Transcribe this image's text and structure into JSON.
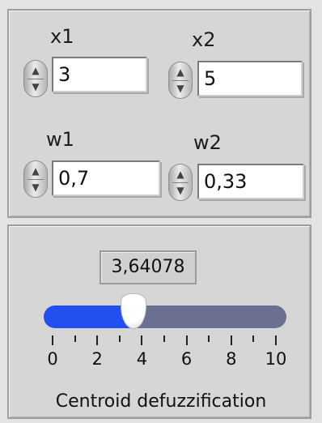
{
  "inputs": {
    "x1": {
      "label": "x1",
      "value": "3"
    },
    "x2": {
      "label": "x2",
      "value": "5"
    },
    "w1": {
      "label": "w1",
      "value": "0,7"
    },
    "w2": {
      "label": "w2",
      "value": "0,33"
    }
  },
  "slider": {
    "display_value": "3,64078",
    "value": 3.64078,
    "min": 0,
    "max": 10,
    "tick_labels": [
      "0",
      "2",
      "4",
      "6",
      "8",
      "10"
    ],
    "caption": "Centroid defuzzification",
    "fill_color": "#2250f0",
    "track_color": "#6b6f92"
  },
  "icons": {
    "stepper": "up-down-arrow-icon"
  }
}
